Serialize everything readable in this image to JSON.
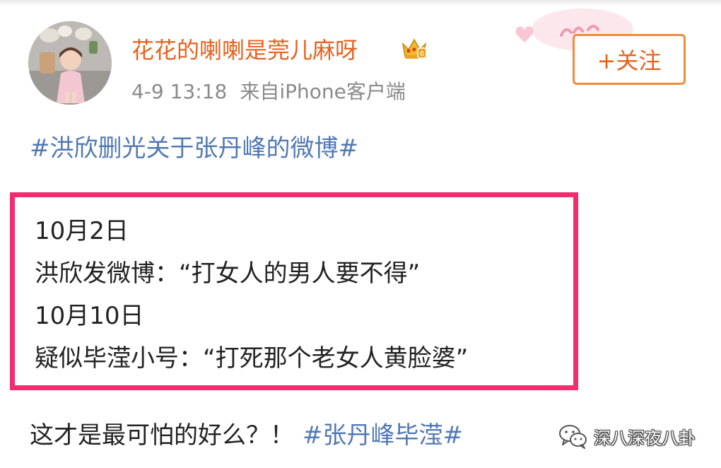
{
  "post": {
    "author": {
      "name": "花花的喇喇是莞儿麻呀",
      "badge_icon": "crown-icon",
      "avatar_icon": "avatar-photo"
    },
    "time": "4-9 13:18",
    "source": "来自iPhone客户端",
    "follow_label": "+关注",
    "hashtag": "#洪欣删光关于张丹峰的微博#",
    "highlight_lines": [
      "10月2日",
      "洪欣发微博：“打女人的男人要不得”",
      "10月10日",
      "疑似毕滢小号：“打死那个老女人黄脸婆”"
    ],
    "comment_text": "这才是最可怕的好么？！",
    "comment_tag": "#张丹峰毕滢#"
  },
  "watermark": {
    "text": "深八深夜八卦",
    "icon": "wechat-icon"
  },
  "colors": {
    "username": "#e8611d",
    "hashtag": "#5179b5",
    "highlight_border": "#f22c6e",
    "meta": "#8a8a8a",
    "follow_border": "#ef8a3e"
  }
}
